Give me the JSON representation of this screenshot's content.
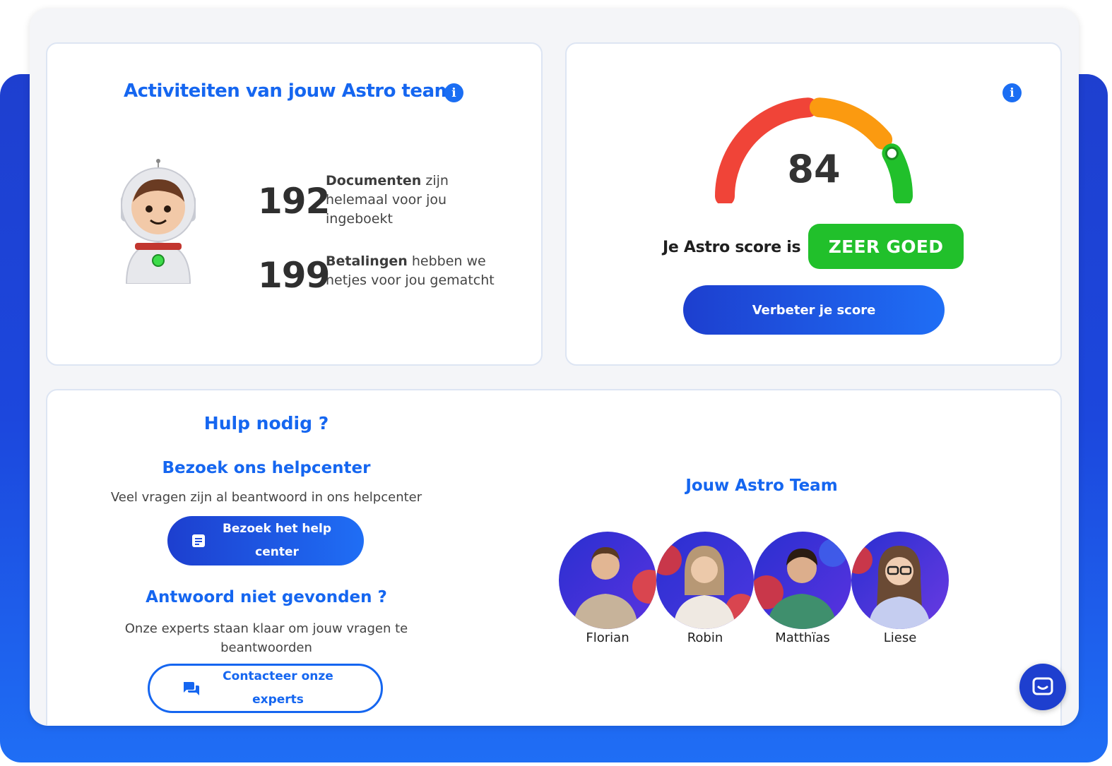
{
  "activity": {
    "title": "Activiteiten van jouw Astro team",
    "stats": [
      {
        "number": "192",
        "bold": "Documenten",
        "rest": " zijn helemaal voor jou ingeboekt"
      },
      {
        "number": "199",
        "bold": "Betalingen",
        "rest": " hebben we netjes voor jou gematcht"
      }
    ]
  },
  "score": {
    "value": "84",
    "label": "Je Astro score is",
    "badge": "ZEER GOED",
    "badge_color": "#21c02b",
    "gauge_fraction": 0.84,
    "button": "Verbeter je score"
  },
  "help": {
    "title": "Hulp nodig ?",
    "helpcenter_title": "Bezoek ons helpcenter",
    "helpcenter_text": "Veel vragen zijn al beantwoord in ons helpcenter",
    "helpcenter_button": "Bezoek het help center",
    "notfound_title": "Antwoord niet gevonden ?",
    "notfound_text": "Onze experts staan klaar om jouw vragen te beantwoorden",
    "contact_button": "Contacteer onze experts"
  },
  "team": {
    "title": "Jouw Astro Team",
    "members": [
      {
        "name": "Florian"
      },
      {
        "name": "Robin"
      },
      {
        "name": "Matthïas"
      },
      {
        "name": "Liese"
      }
    ]
  },
  "colors": {
    "accent": "#1566f0",
    "brand_blue": "#1e3fcf",
    "gauge_red": "#f04438",
    "gauge_orange": "#fb9a10",
    "gauge_green": "#21c02b"
  },
  "icons": [
    "info-icon",
    "document-icon",
    "chat-bubbles-icon",
    "chat-icon"
  ]
}
